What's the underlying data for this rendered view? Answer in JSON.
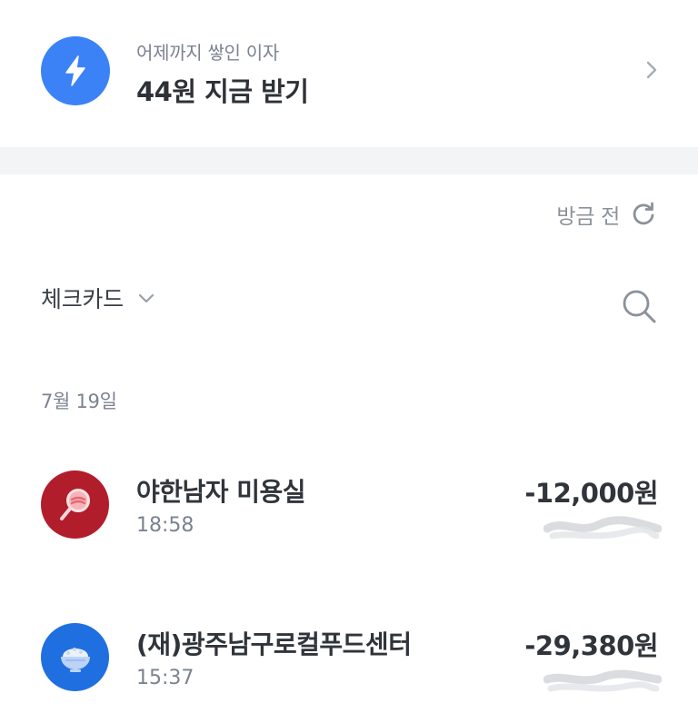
{
  "interest_banner": {
    "subtitle": "어제까지 쌓인 이자",
    "title": "44원 지금 받기",
    "icon": "lightning-icon",
    "icon_color": "#3b82f6"
  },
  "refresh": {
    "label": "방금 전",
    "icon": "refresh-icon"
  },
  "filter": {
    "selected": "체크카드",
    "icon": "chevron-down-icon"
  },
  "search": {
    "icon": "search-icon"
  },
  "date_group": "7월 19일",
  "transactions": [
    {
      "name": "야한남자 미용실",
      "time": "18:58",
      "amount": "-12,000원",
      "icon": "magnifier-lollipop-icon",
      "icon_color": "#b21d2b"
    },
    {
      "name": "(재)광주남구로컬푸드센터",
      "time": "15:37",
      "amount": "-29,380원",
      "icon": "rice-bowl-icon",
      "icon_color": "#1f6fe0"
    }
  ]
}
